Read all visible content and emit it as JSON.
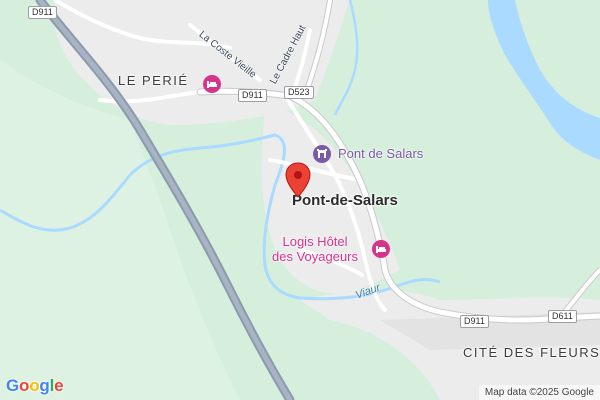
{
  "map": {
    "places": {
      "le_perie": "LE PERIÉ",
      "town": "Pont-de-Salars",
      "cite_des_fleurs": "CITÉ DES FLEURS"
    },
    "pois": {
      "pont_de_salars": "Pont de Salars",
      "hotel_line1": "Logis Hôtel",
      "hotel_line2": "des Voyageurs"
    },
    "streets": {
      "coste_vieille": "La Coste Vieille",
      "cadre_haut": "Le Cadre Haut"
    },
    "rivers": {
      "viaur": "Viaur"
    },
    "roads": {
      "d911_top": "D911",
      "d911_mid": "D911",
      "d523": "D523",
      "d911_bottom": "D911",
      "d611": "D611"
    },
    "icons": {
      "marker": "map-marker-icon",
      "hotel": "hotel-bed-icon",
      "landmark": "landmark-icon"
    },
    "colors": {
      "vegetation": "#d6efdd",
      "urban": "#ececec",
      "water": "#aadaff",
      "motorway": "#8b9aad",
      "marker": "#ea4335",
      "hotel": "#d6338c",
      "landmark": "#7b5aa6"
    }
  },
  "branding": {
    "logo": {
      "g1": "G",
      "o1": "o",
      "o2": "o",
      "g2": "g",
      "l": "l",
      "e": "e"
    },
    "attribution": "Map data ©2025 Google"
  }
}
